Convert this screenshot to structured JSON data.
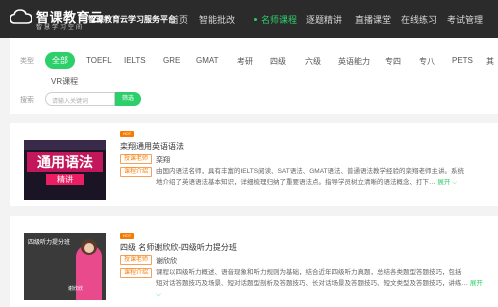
{
  "header": {
    "logo_main": "智课教育云",
    "logo_sub": "智慧学习空间",
    "platform": "智课教育云学习服务平台",
    "nav": [
      {
        "label": "首页",
        "active": false
      },
      {
        "label": "智能批改",
        "active": false
      },
      {
        "label": "名师课程",
        "active": true
      },
      {
        "label": "逐题精讲",
        "active": false
      },
      {
        "label": "直播课堂",
        "active": false
      },
      {
        "label": "在线练习",
        "active": false
      },
      {
        "label": "考试管理",
        "active": false
      }
    ]
  },
  "filter": {
    "category_label": "类型",
    "categories": [
      "全部",
      "TOEFL",
      "IELTS",
      "GRE",
      "GMAT",
      "考研",
      "四级",
      "六级",
      "英语能力",
      "专四",
      "专八",
      "PETS",
      "其"
    ],
    "categories_row2": [
      "VR课程"
    ],
    "search_label": "搜索",
    "search_placeholder": "请输入关键词",
    "search_button": "筛选"
  },
  "courses": [
    {
      "hot": "HOT",
      "title": "栾翔通用英语语法",
      "teacher_tag": "授课老师",
      "teacher": "栾翔",
      "intro_tag": "课程介绍",
      "desc_line1": "由国内语法名师，具有丰富的IELTS阅读、SAT语法、GMAT语法、普通语法教学经验的栾翔老师主讲。系统",
      "desc_line2": "地介绍了英语语法基本知识，详细梳理归纳了重要语法点。指导学员树立清晰的语法概念、打下…",
      "expand": "展开",
      "thumb_text1": "通用语法",
      "thumb_text2": "精讲"
    },
    {
      "hot": "HOT",
      "title": "四级 名师谢欣欣-四级听力提分班",
      "teacher_tag": "授课老师",
      "teacher": "谢欣欣",
      "intro_tag": "课程介绍",
      "desc_line1": "课程以四级听力概述、语音现象和听力规则为基础，结合近年四级听力真题，总结各类题型答题技巧，包括",
      "desc_line2": "短对话答题技巧及场景、短对话题型剖析及答题技巧、长对话场景及答题技巧、短文类型及答题技巧，讲练…",
      "expand": "展开",
      "thumb_title": "四级听力提分班",
      "thumb_caption": "谢欣欣"
    }
  ],
  "colors": {
    "accent": "#2dcf6a",
    "nav_bg": "#2b2b2b",
    "tag": "#f57c00"
  }
}
